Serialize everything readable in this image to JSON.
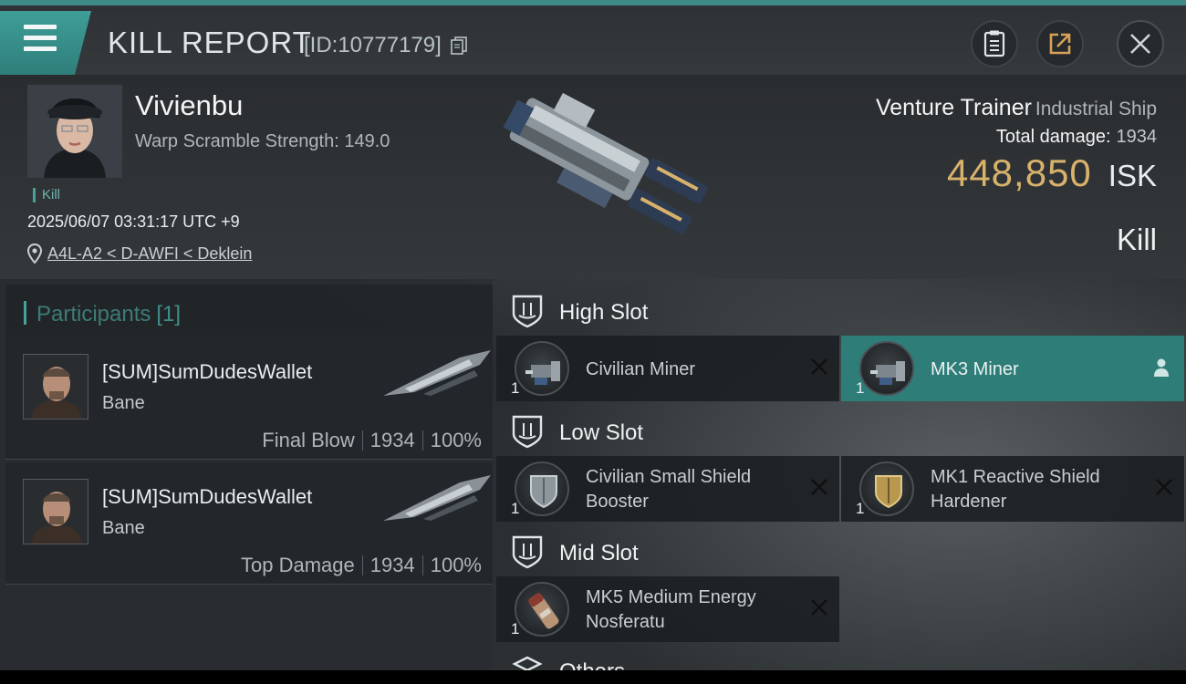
{
  "header": {
    "title": "KILL REPORT",
    "id_text": "[ID:10777179]"
  },
  "victim": {
    "name": "Vivienbu",
    "warp_scramble": "Warp Scramble Strength: 149.0",
    "tag": "Kill",
    "datetime": "2025/06/07 03:31:17 UTC +9",
    "location": "A4L-A2 < D-AWFI < Deklein",
    "ship_name": "Venture Trainer",
    "ship_class": "Industrial Ship",
    "total_damage_label": "Total damage:",
    "total_damage": "1934",
    "isk_value": "448,850",
    "isk_unit": "ISK",
    "result": "Kill"
  },
  "participants": {
    "title": "Participants",
    "count": "[1]",
    "items": [
      {
        "name": "[SUM]SumDudesWallet",
        "ship": "Bane",
        "role": "Final Blow",
        "damage": "1934",
        "percent": "100%"
      },
      {
        "name": "[SUM]SumDudesWallet",
        "ship": "Bane",
        "role": "Top Damage",
        "damage": "1934",
        "percent": "100%"
      }
    ]
  },
  "slots": {
    "high": {
      "label": "High Slot",
      "modules": [
        {
          "name": "Civilian Miner",
          "qty": "1"
        },
        {
          "name": "MK3 Miner",
          "qty": "1"
        }
      ]
    },
    "low": {
      "label": "Low Slot",
      "modules": [
        {
          "name": "Civilian Small Shield Booster",
          "qty": "1"
        },
        {
          "name": "MK1 Reactive Shield Hardener",
          "qty": "1"
        }
      ]
    },
    "mid": {
      "label": "Mid Slot",
      "modules": [
        {
          "name": "MK5 Medium Energy Nosferatu",
          "qty": "1"
        }
      ]
    },
    "others": {
      "label": "Others"
    }
  },
  "colors": {
    "accent": "#3f9e98",
    "isk": "#d8b26b",
    "active_module": "#2f7d79"
  },
  "icons": {
    "menu": "hamburger-icon",
    "copy": "copy-icon",
    "report": "clipboard-icon",
    "share": "share-icon",
    "close": "close-icon",
    "location": "map-pin-icon",
    "slot": "shield-slot-icon",
    "destroyed": "x-icon",
    "dropped": "person-icon"
  }
}
